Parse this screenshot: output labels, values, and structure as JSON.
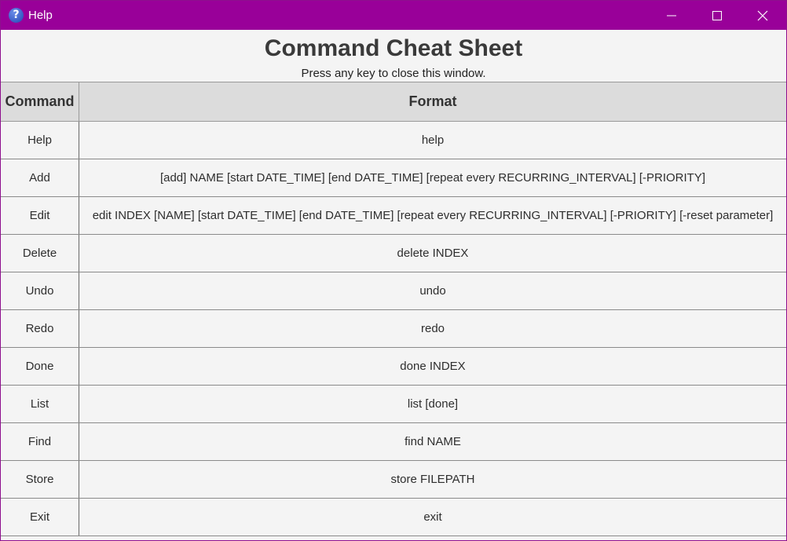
{
  "window": {
    "title": "Help",
    "icon": "help-question-icon",
    "accent_color": "#990099"
  },
  "sheet": {
    "title": "Command Cheat Sheet",
    "subtitle": "Press any key to close this window."
  },
  "table": {
    "headers": {
      "command": "Command",
      "format": "Format"
    },
    "rows": [
      {
        "command": "Help",
        "format": "help"
      },
      {
        "command": "Add",
        "format": "[add] NAME [start DATE_TIME] [end DATE_TIME] [repeat every RECURRING_INTERVAL] [-PRIORITY]"
      },
      {
        "command": "Edit",
        "format": "edit INDEX [NAME] [start DATE_TIME] [end DATE_TIME] [repeat every RECURRING_INTERVAL] [-PRIORITY] [-reset parameter]"
      },
      {
        "command": "Delete",
        "format": "delete INDEX"
      },
      {
        "command": "Undo",
        "format": "undo"
      },
      {
        "command": "Redo",
        "format": "redo"
      },
      {
        "command": "Done",
        "format": "done INDEX"
      },
      {
        "command": "List",
        "format": "list [done]"
      },
      {
        "command": "Find",
        "format": "find NAME"
      },
      {
        "command": "Store",
        "format": "store FILEPATH"
      },
      {
        "command": "Exit",
        "format": "exit"
      }
    ]
  }
}
